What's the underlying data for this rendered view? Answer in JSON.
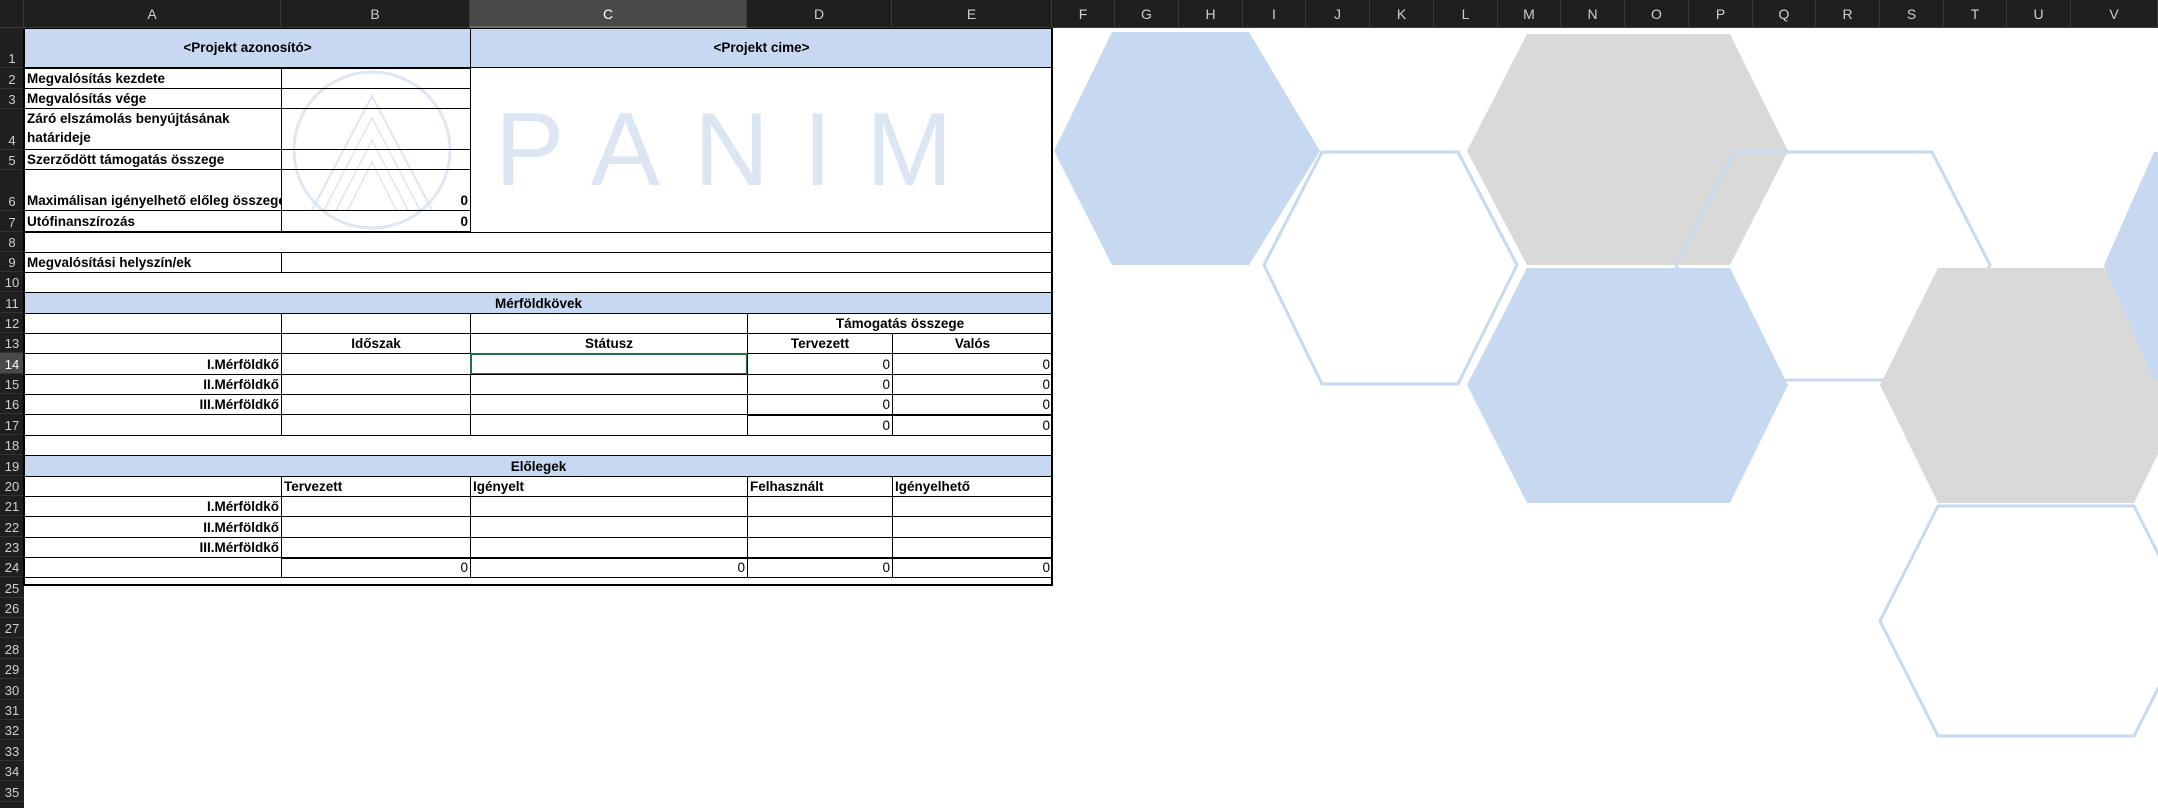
{
  "columns": [
    "A",
    "B",
    "C",
    "D",
    "E",
    "F",
    "G",
    "H",
    "I",
    "J",
    "K",
    "L",
    "M",
    "N",
    "O",
    "P",
    "Q",
    "R",
    "S",
    "T",
    "U",
    "V"
  ],
  "rows": [
    "1",
    "2",
    "3",
    "4",
    "5",
    "6",
    "7",
    "8",
    "9",
    "10",
    "11",
    "12",
    "13",
    "14",
    "15",
    "16",
    "17",
    "18",
    "19",
    "20",
    "21",
    "22",
    "23",
    "24",
    "25",
    "26",
    "27",
    "28",
    "29",
    "30",
    "31",
    "32",
    "33",
    "34",
    "35"
  ],
  "selected_column": "C",
  "selected_row": "14",
  "header": {
    "project_id": "<Projekt azonosító>",
    "project_title": "<Projekt cime>"
  },
  "info": {
    "start": "Megvalósítás kezdete",
    "end": "Megvalósítás vége",
    "deadline": "Záró elszámolás benyújtásának határideje",
    "contract": "Szerződött támogatás összege",
    "advance_max": "Maximálisan igényelhető előleg összege",
    "advance_max_value": "0",
    "post": "Utófinanszírozás",
    "post_value": "0",
    "location": "Megvalósítási helyszín/ek"
  },
  "watermark": {
    "text": "PANIM"
  },
  "milestones": {
    "title": "Mérföldkövek",
    "support_header": "Támogatás összege",
    "period": "Időszak",
    "status": "Státusz",
    "planned": "Tervezett",
    "actual": "Valós",
    "rows": [
      {
        "label": "I.Mérföldkő",
        "planned": "0",
        "actual": "0"
      },
      {
        "label": "II.Mérföldkő",
        "planned": "0",
        "actual": "0"
      },
      {
        "label": "III.Mérföldkő",
        "planned": "0",
        "actual": "0"
      }
    ],
    "total_planned": "0",
    "total_actual": "0"
  },
  "advances": {
    "title": "Előlegek",
    "col_planned": "Tervezett",
    "col_requested": "Igényelt",
    "col_used": "Felhasznált",
    "col_claimable": "Igényelhető",
    "rows": [
      {
        "label": "I.Mérföldkő"
      },
      {
        "label": "II.Mérföldkő"
      },
      {
        "label": "III.Mérföldkő"
      }
    ],
    "total_planned": "0",
    "total_requested": "0",
    "total_used": "0",
    "total_claimable": "0"
  },
  "colors": {
    "header_fill": "#c6d9f1",
    "hex_blue": "#c6d9f1",
    "hex_gray": "#d9d9d9",
    "hex_outline": "#c6d9f1",
    "selection": "#217346"
  }
}
